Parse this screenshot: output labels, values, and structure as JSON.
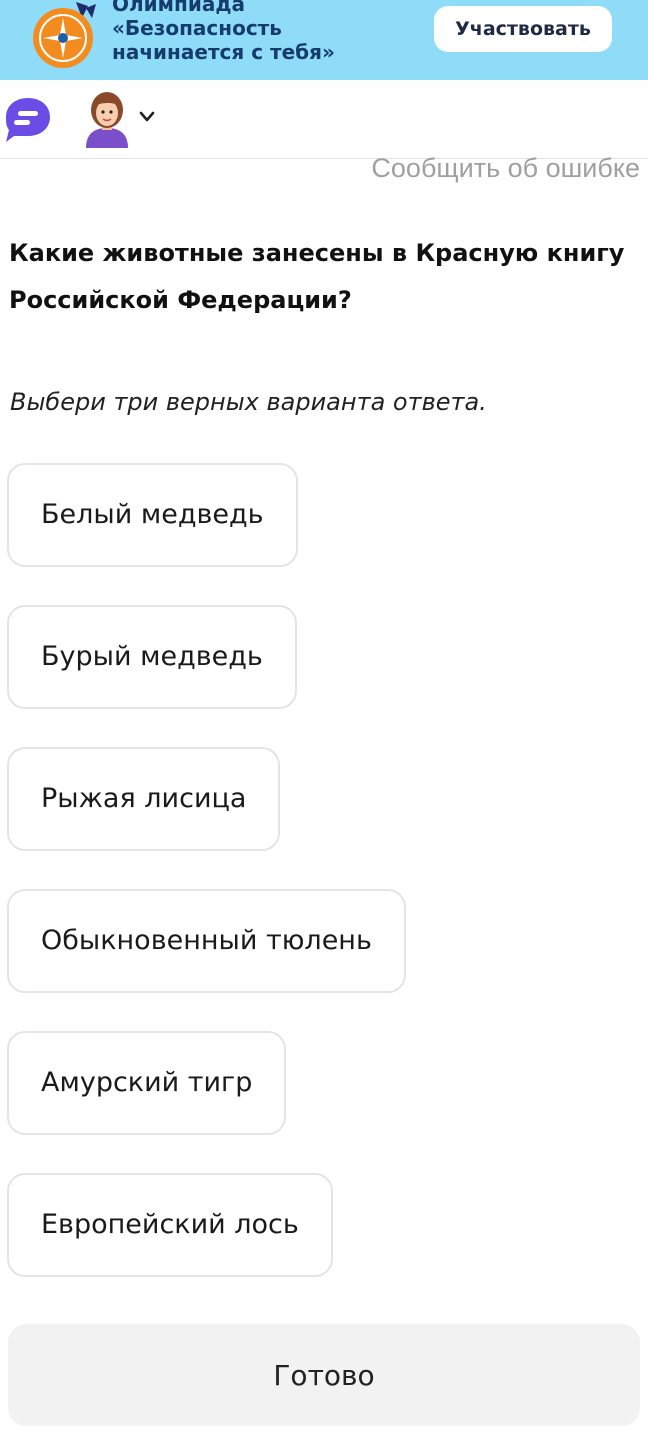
{
  "banner": {
    "title_lines": [
      "Олимпиада",
      "«Безопасность",
      "начинается с тебя»"
    ],
    "cta_label": "Участвовать",
    "background_color": "#8fdcf8",
    "logo_icon": "emergency-star-logo"
  },
  "toolbar": {
    "chat_icon": "chat-bubble-icon",
    "avatar_icon": "girl-avatar",
    "dropdown_icon": "chevron-down-icon"
  },
  "report_link": "Сообщить об ошибке",
  "question": {
    "title": "Какие животные занесены в Красную книгу Российской Федерации?",
    "instruction": "Выбери три верных варианта ответа."
  },
  "options": [
    {
      "label": "Белый медведь"
    },
    {
      "label": "Бурый медведь"
    },
    {
      "label": "Рыжая лисица"
    },
    {
      "label": "Обыкновенный тюлень"
    },
    {
      "label": "Амурский тигр"
    },
    {
      "label": "Европейский лось"
    }
  ],
  "done_label": "Готово",
  "colors": {
    "accent_chat": "#6b4de6",
    "logo_orange": "#f28c1e",
    "option_border": "#e4e4e4",
    "done_background": "#f2f2f2"
  }
}
